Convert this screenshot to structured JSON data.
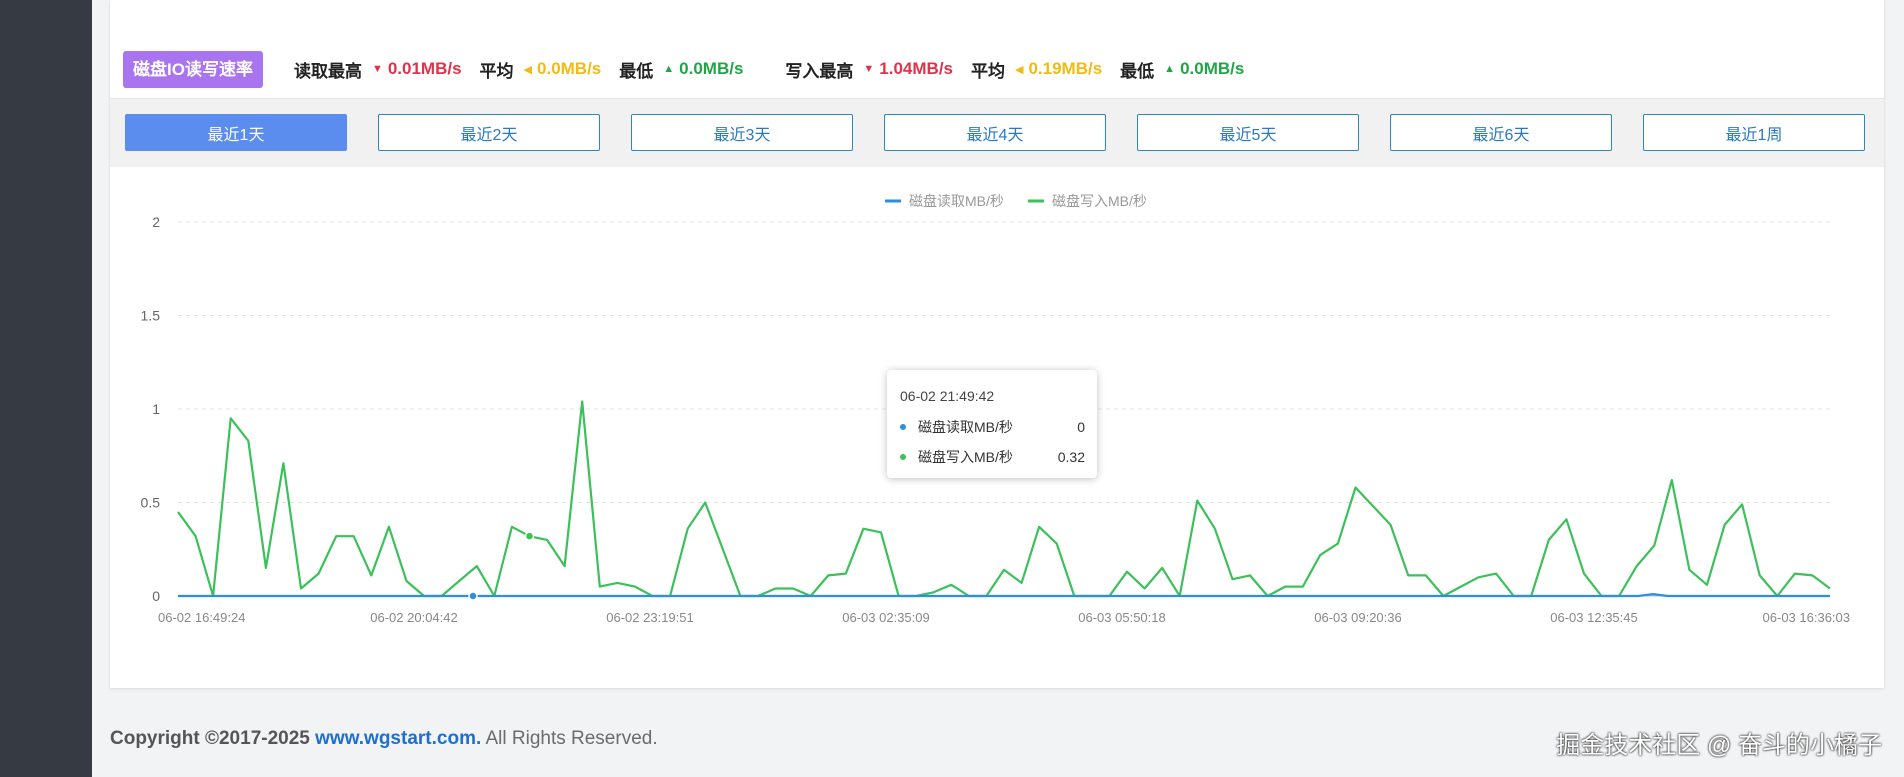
{
  "stats": {
    "badge": "磁盘IO读写速率",
    "read_max_label": "读取最高",
    "read_max_value": "0.01MB/s",
    "read_avg_label": "平均",
    "read_avg_value": "0.0MB/s",
    "read_min_label": "最低",
    "read_min_value": "0.0MB/s",
    "write_max_label": "写入最高",
    "write_max_value": "1.04MB/s",
    "write_avg_label": "平均",
    "write_avg_value": "0.19MB/s",
    "write_min_label": "最低",
    "write_min_value": "0.0MB/s",
    "colors": {
      "max": "#e0334b",
      "avg": "#f2bb12",
      "min": "#22a447"
    },
    "icons": {
      "max": "caret-down-icon",
      "avg": "caret-left-icon",
      "min": "caret-up-icon"
    }
  },
  "tabs": [
    {
      "label": "最近1天",
      "active": true
    },
    {
      "label": "最近2天",
      "active": false
    },
    {
      "label": "最近3天",
      "active": false
    },
    {
      "label": "最近4天",
      "active": false
    },
    {
      "label": "最近5天",
      "active": false
    },
    {
      "label": "最近6天",
      "active": false
    },
    {
      "label": "最近1周",
      "active": false
    }
  ],
  "tooltip": {
    "time": "06-02 21:49:42",
    "rows": [
      {
        "name": "磁盘读取MB/秒",
        "value": "0",
        "color": "#2c8fe0"
      },
      {
        "name": "磁盘写入MB/秒",
        "value": "0.32",
        "color": "#3cc05a"
      }
    ]
  },
  "chart_data": {
    "type": "line",
    "title": "",
    "legend_position": "top-center",
    "ylim": [
      0,
      2
    ],
    "yticks": [
      "0",
      "0.5",
      "1",
      "1.5",
      "2"
    ],
    "xtick_labels": [
      "06-02 16:49:24",
      "06-02 20:04:42",
      "06-02 23:19:51",
      "06-03 02:35:09",
      "06-03 05:50:18",
      "06-03 09:20:36",
      "06-03 12:35:45",
      "06-03 16:36:03"
    ],
    "grid": true,
    "colors": {
      "read": "#2c8fe0",
      "write": "#3cc05a"
    },
    "series": [
      {
        "name": "磁盘读取MB/秒",
        "values": [
          0,
          0,
          0,
          0,
          0,
          0,
          0,
          0,
          0,
          0,
          0,
          0,
          0,
          0,
          0,
          0,
          0,
          0,
          0,
          0,
          0,
          0,
          0,
          0,
          0,
          0,
          0,
          0,
          0,
          0,
          0,
          0,
          0,
          0,
          0,
          0,
          0,
          0,
          0,
          0,
          0,
          0,
          0,
          0,
          0,
          0,
          0,
          0,
          0,
          0,
          0,
          0,
          0,
          0,
          0,
          0,
          0,
          0,
          0,
          0,
          0,
          0,
          0,
          0,
          0,
          0,
          0,
          0,
          0,
          0,
          0,
          0,
          0,
          0,
          0,
          0,
          0,
          0,
          0,
          0,
          0,
          0,
          0,
          0,
          0,
          0,
          0,
          0,
          0,
          0,
          0,
          0,
          0,
          0,
          0,
          0,
          0,
          0,
          0,
          0,
          0.01,
          0,
          0,
          0,
          0,
          0,
          0,
          0,
          0,
          0,
          0,
          0,
          0
        ]
      },
      {
        "name": "磁盘写入MB/秒",
        "values": [
          0.45,
          0.32,
          0,
          0.95,
          0.83,
          0.15,
          0.71,
          0.04,
          0.12,
          0.32,
          0.32,
          0.11,
          0.37,
          0.08,
          0,
          0,
          0.08,
          0.16,
          0,
          0.37,
          0.32,
          0.3,
          0.16,
          1.04,
          0.05,
          0.07,
          0.05,
          0,
          0,
          0.36,
          0.5,
          0.25,
          0,
          0,
          0.04,
          0.04,
          0,
          0.11,
          0.12,
          0.36,
          0.34,
          0,
          0,
          0.02,
          0.06,
          0,
          0,
          0.14,
          0.07,
          0.37,
          0.28,
          0,
          0,
          0,
          0.13,
          0.04,
          0.15,
          0,
          0.51,
          0.36,
          0.09,
          0.11,
          0,
          0.05,
          0.05,
          0.22,
          0.28,
          0.58,
          0.48,
          0.38,
          0.11,
          0.11,
          0,
          0.05,
          0.1,
          0.12,
          0,
          0,
          0.3,
          0.41,
          0.12,
          0,
          0,
          0.16,
          0.27,
          0.62,
          0.14,
          0.06,
          0.38,
          0.49,
          0.11,
          0,
          0.12,
          0.11,
          0.04
        ]
      }
    ]
  },
  "footer": {
    "copyright": "Copyright ©2017-2025",
    "link": "www.wgstart.com.",
    "rights": "All Rights Reserved."
  },
  "watermark": "掘金技术社区 @ 奋斗的小橘子"
}
